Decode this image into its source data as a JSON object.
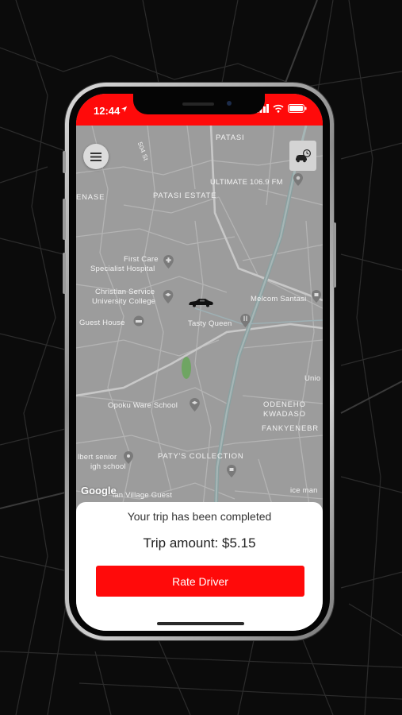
{
  "status_bar": {
    "time": "12:44"
  },
  "map": {
    "labels": {
      "patasi": "PATASI",
      "patasi_estate": "PATASI ESTATE",
      "enase": "ENASE",
      "street_504": "504 St",
      "ultimate": "ULTIMATE 106.9 FM",
      "first_care_1": "First Care",
      "first_care_2": "Specialist Hospital",
      "christian_1": "Christian Service",
      "christian_2": "University College",
      "guest_house": "Guest House",
      "tasty_queen": "Tasty Queen",
      "melcom": "Melcom Santasi",
      "opoku": "Opoku Ware School",
      "odeneho_1": "ODENEHO",
      "odeneho_2": "KWADASO",
      "fankyenebra": "FANKYENEBR",
      "unio": "Unio",
      "patys": "PATY'S COLLECTION",
      "albert_1": "lbert senior",
      "albert_2": "igh school",
      "village": "ian Village Guest",
      "ice": "ice man",
      "google": "Google"
    }
  },
  "sheet": {
    "message": "Your trip has been completed",
    "amount": "Trip amount: $5.15",
    "rate_button": "Rate Driver"
  },
  "colors": {
    "accent": "#ff0a0a",
    "map_bg": "#9c9c9c"
  }
}
